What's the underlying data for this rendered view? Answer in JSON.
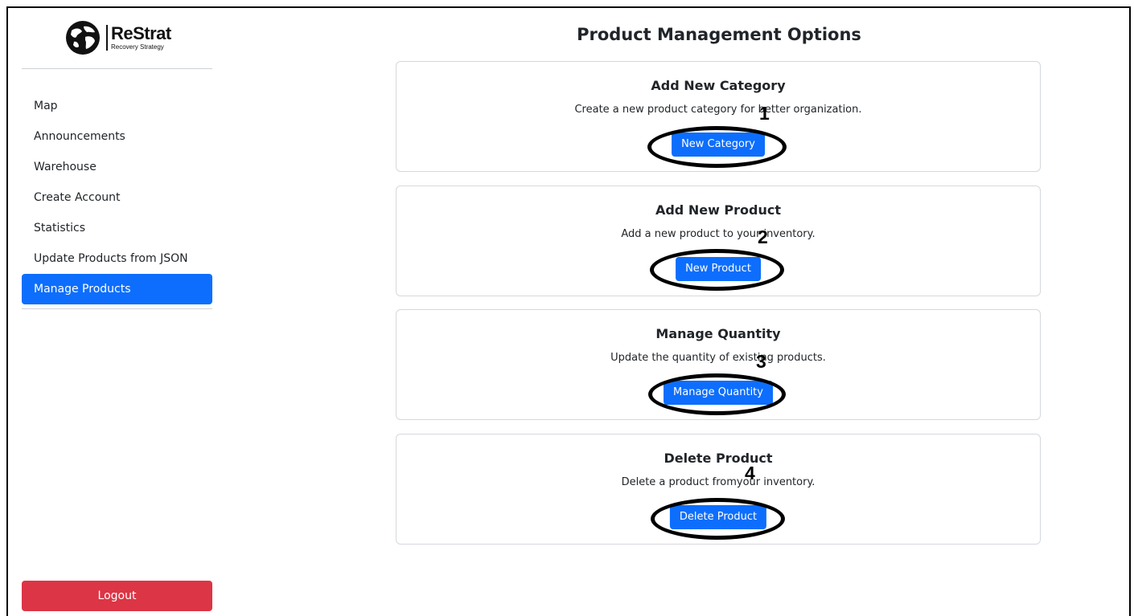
{
  "brand": {
    "name": "ReStrat",
    "tagline": "Recovery Strategy",
    "logo_icon": "globe-icon"
  },
  "sidebar": {
    "items": [
      {
        "label": "Map"
      },
      {
        "label": "Announcements"
      },
      {
        "label": "Warehouse"
      },
      {
        "label": "Create Account"
      },
      {
        "label": "Statistics"
      },
      {
        "label": "Update Products from JSON"
      },
      {
        "label": "Manage Products",
        "active": true
      }
    ],
    "logout_label": "Logout"
  },
  "main": {
    "title": "Product Management Options",
    "cards": [
      {
        "title": "Add New Category",
        "text": "Create a new product category for better organization.",
        "button": "New Category",
        "marker": "1"
      },
      {
        "title": "Add New Product",
        "text": "Add a new product to your inventory.",
        "button": "New Product",
        "marker": "2"
      },
      {
        "title": "Manage Quantity",
        "text": "Update the quantity of existing products.",
        "button": "Manage Quantity",
        "marker": "3"
      },
      {
        "title": "Delete Product",
        "text": "Delete a product fromyour inventory.",
        "button": "Delete Product",
        "marker": "4"
      }
    ]
  },
  "colors": {
    "primary": "#0d6efd",
    "danger": "#dc3545",
    "annotation": "#000000"
  }
}
